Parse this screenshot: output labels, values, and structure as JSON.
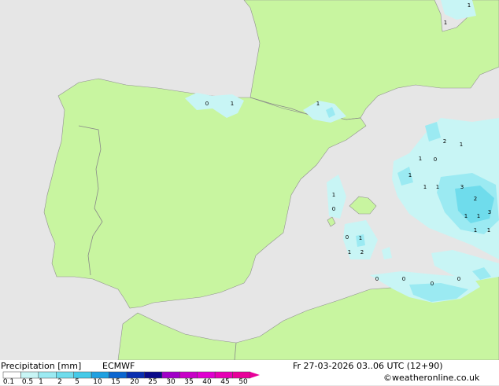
{
  "legend": {
    "title": "Precipitation [mm]",
    "model": "ECMWF",
    "ticks": [
      "0.1",
      "0.5",
      "1",
      "2",
      "5",
      "10",
      "15",
      "20",
      "25",
      "30",
      "35",
      "40",
      "45",
      "50"
    ],
    "colors": [
      "#ffffff",
      "#c8f5f5",
      "#9beaf2",
      "#6fdcec",
      "#45cae8",
      "#1fa0e0",
      "#0b66d0",
      "#0a2fb0",
      "#0a0a8a",
      "#a000c8",
      "#c800c8",
      "#e000d0",
      "#e600b4",
      "#e8009a"
    ]
  },
  "footer": {
    "datetime": "Fr 27-03-2026 03..06 UTC (12+90)",
    "credit": "©weatheronline.co.uk"
  },
  "map": {
    "colors": {
      "land": "#c8f5a0",
      "sea": "#e6e6e6",
      "border": "#888888",
      "coast": "#909090",
      "precip_light": "#c8f5f5",
      "precip_mid": "#9beaf2"
    },
    "precip_values": [
      "0",
      "1",
      "1",
      "2",
      "1",
      "3",
      "2",
      "1",
      "3",
      "1",
      "1",
      "0",
      "1",
      "0",
      "1",
      "2",
      "1",
      "1",
      "0",
      "1",
      "1",
      "1",
      "1",
      "1",
      "1",
      "0",
      "0",
      "0",
      "0"
    ]
  }
}
